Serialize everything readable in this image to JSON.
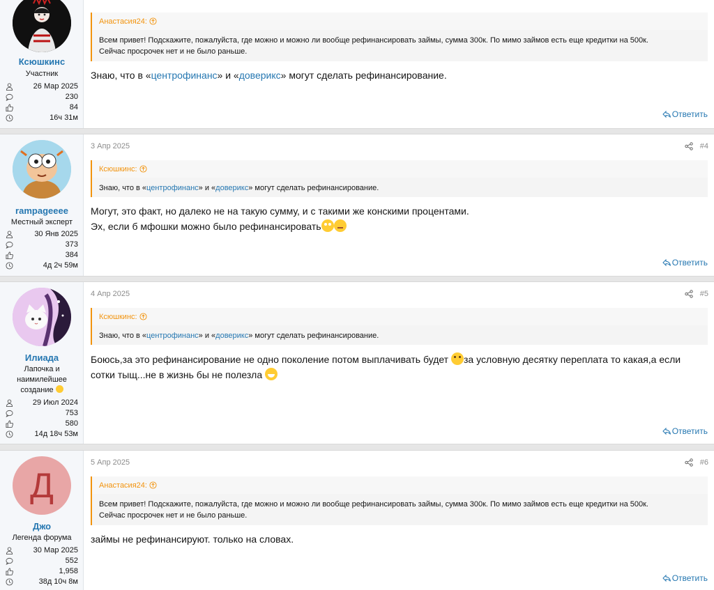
{
  "colors": {
    "accent": "#2577b1",
    "quote": "#f2930d",
    "muted": "#8c8c8c"
  },
  "reply_label": "Ответить",
  "posts": [
    {
      "user": {
        "name": "Ксюшкинс",
        "title": "Участник",
        "joined": "26 Мар 2025",
        "messages": "230",
        "reactions": "84",
        "online": "16ч 31м"
      },
      "quote": {
        "author": "Анастасия24:",
        "line1": "Всем привет! Подскажите, пожалуйста, где можно и можно ли вообще рефинансировать займы, сумма 300к. По мимо займов есть еще кредитки на 500к.",
        "line2": "Сейчас просрочек нет и не было раньше."
      },
      "text": {
        "a": "Знаю, что в «",
        "link1": "центрофинанс",
        "b": "» и «",
        "link2": "доверикс",
        "c": "» могут сделать рефинансирование."
      }
    },
    {
      "date": "3 Апр 2025",
      "num": "#4",
      "user": {
        "name": "rampageeee",
        "title": "Местный эксперт",
        "joined": "30 Янв 2025",
        "messages": "373",
        "reactions": "384",
        "online": "4д 2ч 59м"
      },
      "quote": {
        "author": "Ксюшкинс:",
        "a": "Знаю, что в «",
        "link1": "центрофинанс",
        "b": "» и «",
        "link2": "доверикс",
        "c": "» могут сделать рефинансирование."
      },
      "text": {
        "line1": "Могут, это факт, но далеко не на такую сумму, и с такими же конскими процентами.",
        "line2": "Эх, если б мфошки можно было рефинансировать"
      }
    },
    {
      "date": "4 Апр 2025",
      "num": "#5",
      "user": {
        "name": "Илиада",
        "title1": "Лапочка и",
        "title2": "наимилейшее",
        "title3": "создание",
        "joined": "29 Июл 2024",
        "messages": "753",
        "reactions": "580",
        "online": "14д 18ч 53м"
      },
      "quote": {
        "author": "Ксюшкинс:",
        "a": "Знаю, что в «",
        "link1": "центрофинанс",
        "b": "» и «",
        "link2": "доверикс",
        "c": "» могут сделать рефинансирование."
      },
      "text": {
        "a": "Боюсь,за это рефинансирование не одно поколение потом выплачивать будет ",
        "b": "за условную десятку переплата то какая,а если",
        "c": "сотки тыщ...не в жизнь бы не полезла "
      }
    },
    {
      "date": "5 Апр 2025",
      "num": "#6",
      "user": {
        "name": "Джо",
        "letter": "Д",
        "title": "Легенда форума",
        "joined": "30 Мар 2025",
        "messages": "552",
        "reactions": "1,958",
        "online": "38д 10ч 8м"
      },
      "quote": {
        "author": "Анастасия24:",
        "line1": "Всем привет! Подскажите, пожалуйста, где можно и можно ли вообще рефинансировать займы, сумма 300к. По мимо займов есть еще кредитки на 500к.",
        "line2": "Сейчас просрочек нет и не было раньше."
      },
      "text": {
        "line1": "займы не рефинансируют. только на словах."
      }
    }
  ]
}
